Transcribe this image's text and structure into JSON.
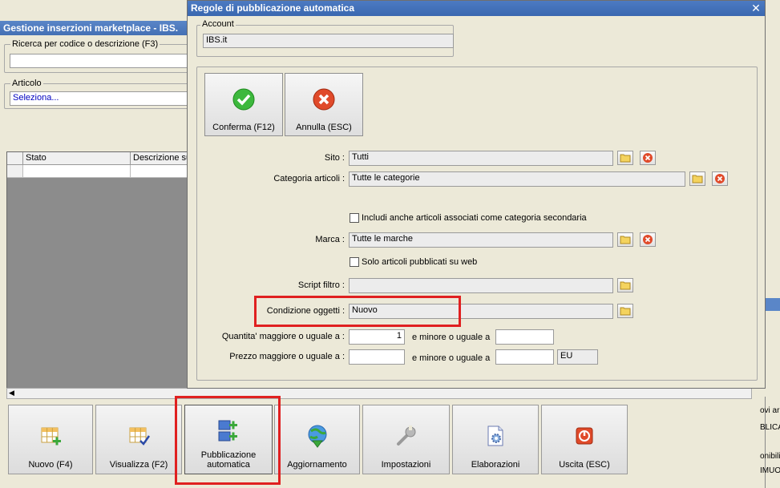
{
  "background_window": {
    "title": "Gestione inserzioni marketplace - IBS.",
    "search": {
      "label": "Ricerca per codice o descrizione (F3)",
      "value": ""
    },
    "article": {
      "label": "Articolo",
      "value": "Seleziona..."
    },
    "grid": {
      "columns": [
        "Stato",
        "Descrizione sul"
      ]
    },
    "side_text": [
      "ovi ar",
      "BLICA",
      "onibili",
      "IMUO"
    ]
  },
  "toolbar": {
    "buttons": [
      {
        "id": "nuovo",
        "label": "Nuovo (F4)",
        "icon": "grid-add-icon"
      },
      {
        "id": "visualizza",
        "label": "Visualizza (F2)",
        "icon": "grid-check-icon"
      },
      {
        "id": "pubblicazione",
        "label": "Pubblicazione automatica",
        "icon": "publish-icon"
      },
      {
        "id": "aggiornamento",
        "label": "Aggiornamento",
        "icon": "globe-download-icon"
      },
      {
        "id": "impostazioni",
        "label": "Impostazioni",
        "icon": "wrench-icon"
      },
      {
        "id": "elaborazioni",
        "label": "Elaborazioni",
        "icon": "document-gear-icon"
      },
      {
        "id": "uscita",
        "label": "Uscita (ESC)",
        "icon": "power-icon"
      }
    ]
  },
  "dialog": {
    "title": "Regole di pubblicazione automatica",
    "account": {
      "label": "Account",
      "value": "IBS.it"
    },
    "confirm_label": "Conferma (F12)",
    "cancel_label": "Annulla (ESC)",
    "sito": {
      "label": "Sito :",
      "value": "Tutti"
    },
    "categoria": {
      "label": "Categoria articoli :",
      "value": "Tutte le categorie"
    },
    "secondary_cat_label": "Includi anche articoli associati come categoria secondaria",
    "marca": {
      "label": "Marca :",
      "value": "Tutte le marche"
    },
    "web_only_label": "Solo articoli pubblicati su web",
    "script": {
      "label": "Script filtro :",
      "value": ""
    },
    "condizione": {
      "label": "Condizione oggetti :",
      "value": "Nuovo"
    },
    "quantita": {
      "label": "Quantita' maggiore o uguale a :",
      "min": "1",
      "max_label": "e minore o uguale a",
      "max": ""
    },
    "prezzo": {
      "label": "Prezzo maggiore o uguale a :",
      "min": "",
      "max_label": "e minore o uguale a",
      "max": "",
      "currency": "EU"
    }
  },
  "colors": {
    "highlight": "#e02020",
    "titlebar": "#3a67b0",
    "link_text": "#0000c0"
  }
}
